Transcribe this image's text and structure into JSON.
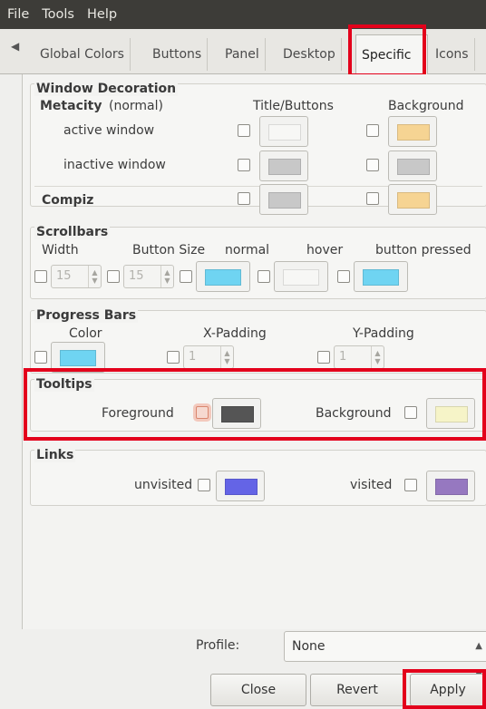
{
  "menu": [
    "File",
    "Tools",
    "Help"
  ],
  "tabs": {
    "scroll_left_icon": "◀",
    "items": [
      "Global Colors",
      "Buttons",
      "Panel",
      "Desktop",
      "Specific",
      "Icons"
    ],
    "active": "Specific"
  },
  "window_decoration": {
    "title": "Window Decoration",
    "metacity_label": "Metacity",
    "metacity_suffix": "(normal)",
    "col_title_buttons": "Title/Buttons",
    "col_background": "Background",
    "active_window": "active window",
    "inactive_window": "inactive window",
    "compiz": "Compiz",
    "colors": {
      "active_title": "#f7f7f5",
      "active_bg": "#f6d493",
      "inactive_title": "#c8c8c8",
      "inactive_bg": "#c8c8c8",
      "compiz_title": "#c8c8c8",
      "compiz_bg": "#f6d493"
    }
  },
  "scrollbars": {
    "title": "Scrollbars",
    "width_label": "Width",
    "button_size_label": "Button Size",
    "normal_label": "normal",
    "hover_label": "hover",
    "pressed_label": "button pressed",
    "width_value": "15",
    "button_size_value": "15",
    "colors": {
      "normal": "#6fd4f2",
      "hover": "#f7f7f5",
      "pressed": "#6fd4f2"
    }
  },
  "progress_bars": {
    "title": "Progress Bars",
    "color_label": "Color",
    "xpad_label": "X-Padding",
    "ypad_label": "Y-Padding",
    "xpad_value": "1",
    "ypad_value": "1",
    "colors": {
      "color": "#6fd4f2"
    }
  },
  "tooltips": {
    "title": "Tooltips",
    "fg_label": "Foreground",
    "bg_label": "Background",
    "colors": {
      "fg": "#555555",
      "bg": "#f6f4c8"
    }
  },
  "links": {
    "title": "Links",
    "unvisited_label": "unvisited",
    "visited_label": "visited",
    "colors": {
      "unvisited": "#6464e6",
      "visited": "#9678c0"
    }
  },
  "footer": {
    "profile_label": "Profile:",
    "profile_value": "None",
    "close_label": "Close",
    "revert_label": "Revert",
    "apply_label": "Apply"
  }
}
